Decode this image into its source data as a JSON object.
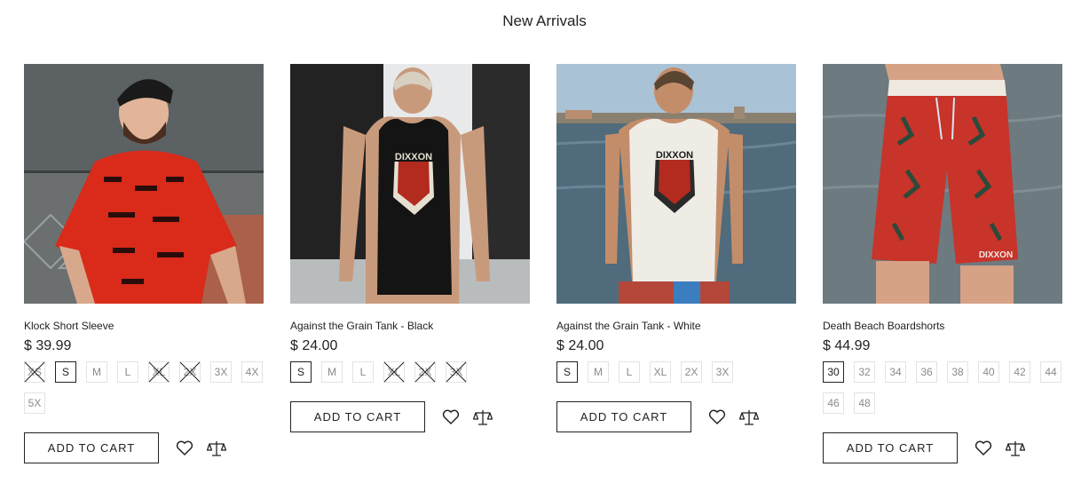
{
  "page": {
    "section_title": "New Arrivals"
  },
  "products": [
    {
      "name": "Klock Short Sleeve",
      "price": "$ 39.99",
      "sizes": [
        {
          "label": "XS",
          "available": false,
          "selected": false
        },
        {
          "label": "S",
          "available": true,
          "selected": true
        },
        {
          "label": "M",
          "available": true,
          "selected": false
        },
        {
          "label": "L",
          "available": true,
          "selected": false
        },
        {
          "label": "XL",
          "available": false,
          "selected": false
        },
        {
          "label": "2X",
          "available": false,
          "selected": false
        },
        {
          "label": "3X",
          "available": true,
          "selected": false
        },
        {
          "label": "4X",
          "available": true,
          "selected": false
        },
        {
          "label": "5X",
          "available": true,
          "selected": false
        }
      ],
      "add_to_cart": "ADD TO CART",
      "image_colors": {
        "bg": "#6b6f70",
        "garment": "#d92a1a"
      }
    },
    {
      "name": "Against the Grain Tank - Black",
      "price": "$ 24.00",
      "sizes": [
        {
          "label": "S",
          "available": true,
          "selected": true
        },
        {
          "label": "M",
          "available": true,
          "selected": false
        },
        {
          "label": "L",
          "available": true,
          "selected": false
        },
        {
          "label": "XL",
          "available": false,
          "selected": false
        },
        {
          "label": "2X",
          "available": false,
          "selected": false
        },
        {
          "label": "3X",
          "available": false,
          "selected": false
        }
      ],
      "add_to_cart": "ADD TO CART",
      "image_colors": {
        "bg": "#cfd2d3",
        "garment": "#141414"
      }
    },
    {
      "name": "Against the Grain Tank - White",
      "price": "$ 24.00",
      "sizes": [
        {
          "label": "S",
          "available": true,
          "selected": true
        },
        {
          "label": "M",
          "available": true,
          "selected": false
        },
        {
          "label": "L",
          "available": true,
          "selected": false
        },
        {
          "label": "XL",
          "available": true,
          "selected": false
        },
        {
          "label": "2X",
          "available": true,
          "selected": false
        },
        {
          "label": "3X",
          "available": true,
          "selected": false
        }
      ],
      "add_to_cart": "ADD TO CART",
      "image_colors": {
        "bg": "#4f6b7c",
        "garment": "#efece6"
      }
    },
    {
      "name": "Death Beach Boardshorts",
      "price": "$ 44.99",
      "sizes": [
        {
          "label": "30",
          "available": true,
          "selected": true
        },
        {
          "label": "32",
          "available": true,
          "selected": false
        },
        {
          "label": "34",
          "available": true,
          "selected": false
        },
        {
          "label": "36",
          "available": true,
          "selected": false
        },
        {
          "label": "38",
          "available": true,
          "selected": false
        },
        {
          "label": "40",
          "available": true,
          "selected": false
        },
        {
          "label": "42",
          "available": true,
          "selected": false
        },
        {
          "label": "44",
          "available": true,
          "selected": false
        },
        {
          "label": "46",
          "available": true,
          "selected": false
        },
        {
          "label": "48",
          "available": true,
          "selected": false
        }
      ],
      "add_to_cart": "ADD TO CART",
      "image_colors": {
        "bg": "#6d7a80",
        "garment": "#c8332a"
      }
    }
  ],
  "icons": {
    "wishlist": "heart-icon",
    "compare": "scale-icon"
  },
  "brand_print": "DIXXON"
}
